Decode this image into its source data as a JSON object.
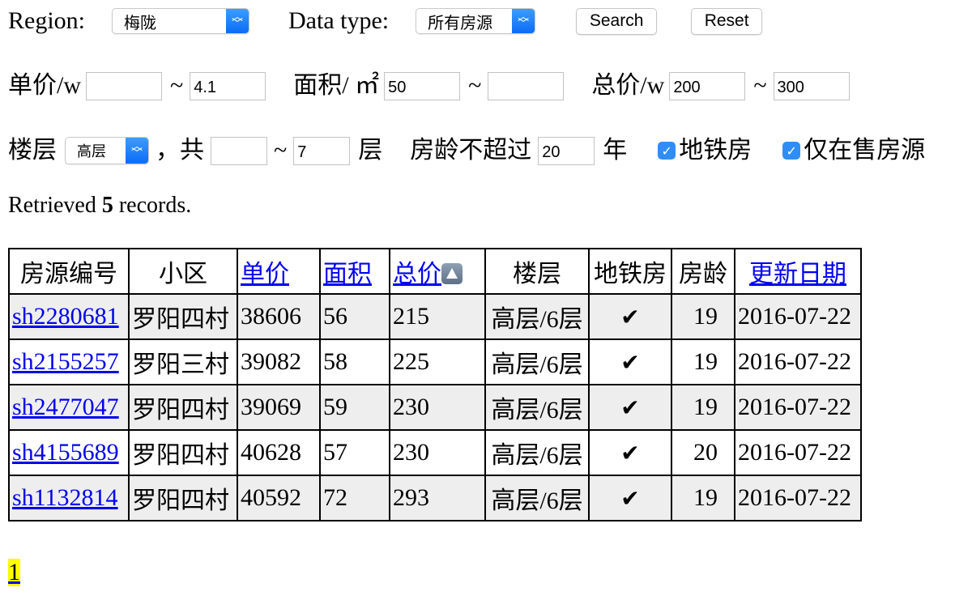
{
  "filters": {
    "region_label": "Region:",
    "region_value": "梅陇",
    "data_type_label": "Data type:",
    "data_type_value": "所有房源",
    "search_button": "Search",
    "reset_button": "Reset",
    "unit_price_label": "单价/w",
    "unit_price_min": "",
    "unit_price_max": "4.1",
    "area_label": "面积/ ㎡",
    "area_min": "50",
    "area_max": "",
    "total_price_label": "总价/w",
    "total_price_min": "200",
    "total_price_max": "300",
    "range_sep": "~",
    "floor_label": "楼层",
    "floor_value": "高层",
    "total_floors_label": "，共",
    "total_floors_min": "",
    "total_floors_max": "7",
    "floors_unit": "层",
    "age_label": "房龄不超过",
    "age_value": "20",
    "age_unit": "年",
    "subway_label": "地铁房",
    "subway_checked": true,
    "on_sale_label": "仅在售房源",
    "on_sale_checked": true
  },
  "status": {
    "prefix": "Retrieved",
    "count": "5",
    "suffix": "records."
  },
  "table": {
    "headers": [
      "房源编号",
      "小区",
      "单价",
      "面积",
      "总价",
      "楼层",
      "地铁房",
      "房龄",
      "更新日期"
    ],
    "sort_indicator": "ascending",
    "rows": [
      {
        "id": "sh2280681",
        "community": "罗阳四村",
        "unit_price": "38606",
        "area": "56",
        "total": "215",
        "floor": "高层/6层",
        "subway": "✔",
        "age": "19",
        "updated": "2016-07-22"
      },
      {
        "id": "sh2155257",
        "community": "罗阳三村",
        "unit_price": "39082",
        "area": "58",
        "total": "225",
        "floor": "高层/6层",
        "subway": "✔",
        "age": "19",
        "updated": "2016-07-22"
      },
      {
        "id": "sh2477047",
        "community": "罗阳四村",
        "unit_price": "39069",
        "area": "59",
        "total": "230",
        "floor": "高层/6层",
        "subway": "✔",
        "age": "19",
        "updated": "2016-07-22"
      },
      {
        "id": "sh4155689",
        "community": "罗阳四村",
        "unit_price": "40628",
        "area": "57",
        "total": "230",
        "floor": "高层/6层",
        "subway": "✔",
        "age": "20",
        "updated": "2016-07-22"
      },
      {
        "id": "sh1132814",
        "community": "罗阳四村",
        "unit_price": "40592",
        "area": "72",
        "total": "293",
        "floor": "高层/6层",
        "subway": "✔",
        "age": "19",
        "updated": "2016-07-22"
      }
    ]
  },
  "pagination": {
    "current_page": "1",
    "highlight_color": "#ffff00"
  }
}
